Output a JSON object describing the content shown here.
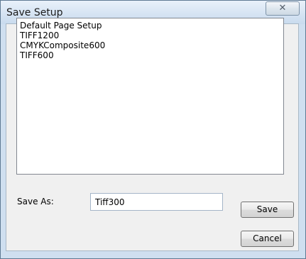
{
  "window": {
    "title": "Save Setup",
    "close_icon": "close-icon"
  },
  "setups_list": {
    "items": [
      "Default Page Setup",
      "TIFF1200",
      "CMYKComposite600",
      "TIFF600"
    ]
  },
  "save_as": {
    "label": "Save As:",
    "value": "Tiff300"
  },
  "buttons": {
    "save": "Save",
    "cancel": "Cancel"
  },
  "colors": {
    "titlebar": "#d6e4f3",
    "client_background": "#f0f0f0"
  }
}
